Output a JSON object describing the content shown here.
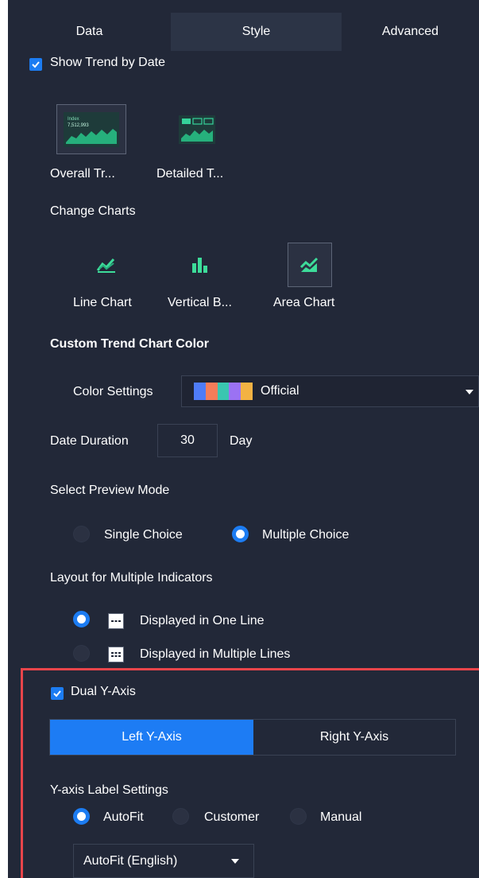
{
  "tabs": [
    {
      "label": "Data"
    },
    {
      "label": "Style"
    },
    {
      "label": "Advanced"
    }
  ],
  "show_trend": {
    "label": "Show Trend by Date",
    "checked": true
  },
  "trend_styles": [
    {
      "label": "Overall Tr...",
      "icon": "overall-trend-thumbnail-icon",
      "thumb_text": [
        "Index",
        "7,512,993"
      ],
      "selected": true
    },
    {
      "label": "Detailed T...",
      "icon": "detailed-trend-thumbnail-icon",
      "selected": false
    }
  ],
  "change_charts": {
    "heading": "Change Charts",
    "items": [
      {
        "label": "Line Chart",
        "icon": "line-chart-icon",
        "selected": false
      },
      {
        "label": "Vertical B...",
        "icon": "vertical-bar-chart-icon",
        "selected": false
      },
      {
        "label": "Area Chart",
        "icon": "area-chart-icon",
        "selected": true
      }
    ]
  },
  "custom_color": {
    "heading": "Custom Trend Chart Color",
    "label": "Color Settings",
    "value": "Official",
    "swatches": [
      "#4f7cf7",
      "#f57d59",
      "#3ac6b0",
      "#9b72f3",
      "#f3b243"
    ]
  },
  "date_duration": {
    "label": "Date Duration",
    "value": "30",
    "unit": "Day"
  },
  "preview_mode": {
    "heading": "Select Preview Mode",
    "options": [
      {
        "label": "Single Choice",
        "selected": false
      },
      {
        "label": "Multiple Choice",
        "selected": true
      }
    ]
  },
  "layout_multi": {
    "heading": "Layout for Multiple Indicators",
    "options": [
      {
        "label": "Displayed in One Line",
        "icon": "single-line-layout-icon",
        "selected": true
      },
      {
        "label": "Displayed in Multiple Lines",
        "icon": "multi-line-layout-icon",
        "selected": false
      }
    ]
  },
  "dual_y": {
    "label": "Dual Y-Axis",
    "checked": true
  },
  "axis_tabs": [
    {
      "label": "Left Y-Axis",
      "active": true
    },
    {
      "label": "Right Y-Axis",
      "active": false
    }
  ],
  "y_label": {
    "heading": "Y-axis Label Settings",
    "options": [
      {
        "label": "AutoFit",
        "selected": true
      },
      {
        "label": "Customer",
        "selected": false
      },
      {
        "label": "Manual",
        "selected": false
      }
    ],
    "dropdown": "AutoFit (English)"
  },
  "colors": {
    "accent": "#1c7cf2",
    "panel": "#222838",
    "highlight_frame": "#e8454b"
  }
}
